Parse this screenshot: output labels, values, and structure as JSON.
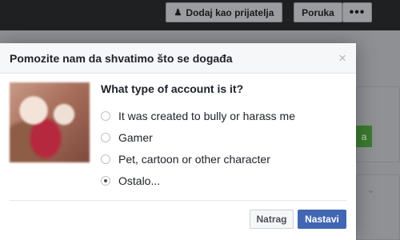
{
  "background": {
    "add_friend_label": "Dodaj kao prijatelja",
    "add_friend_icon": "person-plus-icon",
    "message_label": "Poruka",
    "more_label": "•••",
    "partial_button_text": "a"
  },
  "dialog": {
    "title": "Pomozite nam da shvatimo što se događa",
    "close_label": "×",
    "question": "What type of account is it?",
    "options": [
      {
        "label": "It was created to bully or harass me",
        "selected": false
      },
      {
        "label": "Gamer",
        "selected": false
      },
      {
        "label": "Pet, cartoon or other character",
        "selected": false
      },
      {
        "label": "Ostalo...",
        "selected": true
      }
    ],
    "back_label": "Natrag",
    "next_label": "Nastavi"
  },
  "colors": {
    "primary_button": "#4267b2",
    "header_bg": "#f6f7f9"
  }
}
